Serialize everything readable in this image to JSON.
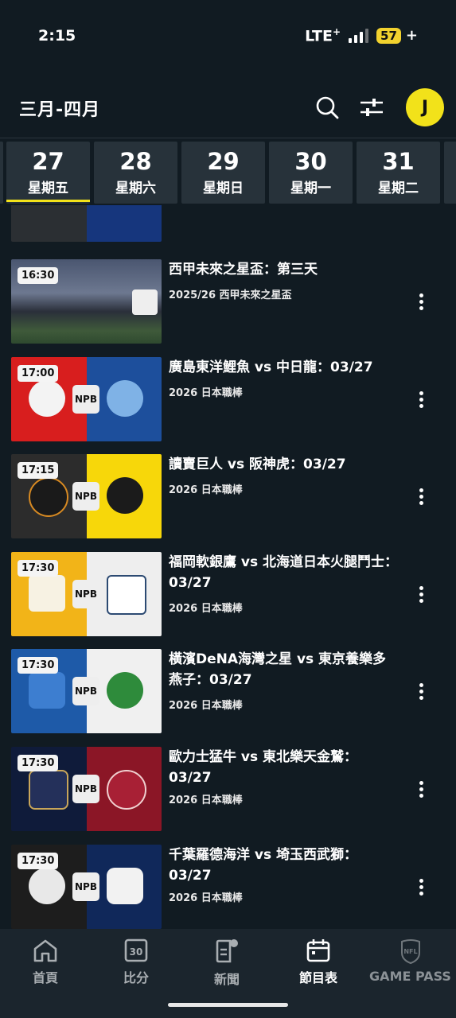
{
  "status": {
    "time": "2:15",
    "network": "LTE",
    "network_sup": "+",
    "battery": "57",
    "battery_plus": "+"
  },
  "header": {
    "title": "三月-四月",
    "avatar_initial": "J"
  },
  "dates": [
    {
      "num": "27",
      "day": "星期五"
    },
    {
      "num": "28",
      "day": "星期六"
    },
    {
      "num": "29",
      "day": "星期日"
    },
    {
      "num": "30",
      "day": "星期一"
    },
    {
      "num": "31",
      "day": "星期二"
    }
  ],
  "events": [
    {
      "time": "16:30",
      "title": "西甲未來之星盃：第三天",
      "subtitle": "2025/26 西甲未來之星盃"
    },
    {
      "time": "17:00",
      "title": "廣島東洋鯉魚 vs 中日龍：03/27",
      "subtitle": "2026 日本職棒",
      "league_badge": "NPB"
    },
    {
      "time": "17:15",
      "title": "讀賣巨人 vs 阪神虎：03/27",
      "subtitle": "2026 日本職棒",
      "league_badge": "NPB"
    },
    {
      "time": "17:30",
      "title": "福岡軟銀鷹 vs 北海道日本火腿鬥士：03/27",
      "subtitle": "2026 日本職棒",
      "league_badge": "NPB"
    },
    {
      "time": "17:30",
      "title": "橫濱DeNA海灣之星 vs 東京養樂多燕子：03/27",
      "subtitle": "2026 日本職棒",
      "league_badge": "NPB"
    },
    {
      "time": "17:30",
      "title": "歐力士猛牛 vs 東北樂天金鷲：03/27",
      "subtitle": "2026 日本職棒",
      "league_badge": "NPB"
    },
    {
      "time": "17:30",
      "title": "千葉羅德海洋 vs 埼玉西武獅：03/27",
      "subtitle": "2026 日本職棒",
      "league_badge": "NPB"
    }
  ],
  "nav": {
    "home": "首頁",
    "scores": "比分",
    "scores_icon_text": "30",
    "news": "新聞",
    "schedule": "節目表",
    "gamepass": "GAME PASS",
    "gamepass_icon_text": "NFL"
  },
  "colors": {
    "accent": "#f2e21a",
    "background": "#111b22",
    "tab_bg": "#27323a",
    "nav_bg": "#1b252d"
  },
  "icons": [
    "search-icon",
    "filter-icon",
    "more-vertical-icon",
    "home-icon",
    "scoreboard-icon",
    "news-icon",
    "calendar-icon",
    "nfl-shield-icon"
  ]
}
